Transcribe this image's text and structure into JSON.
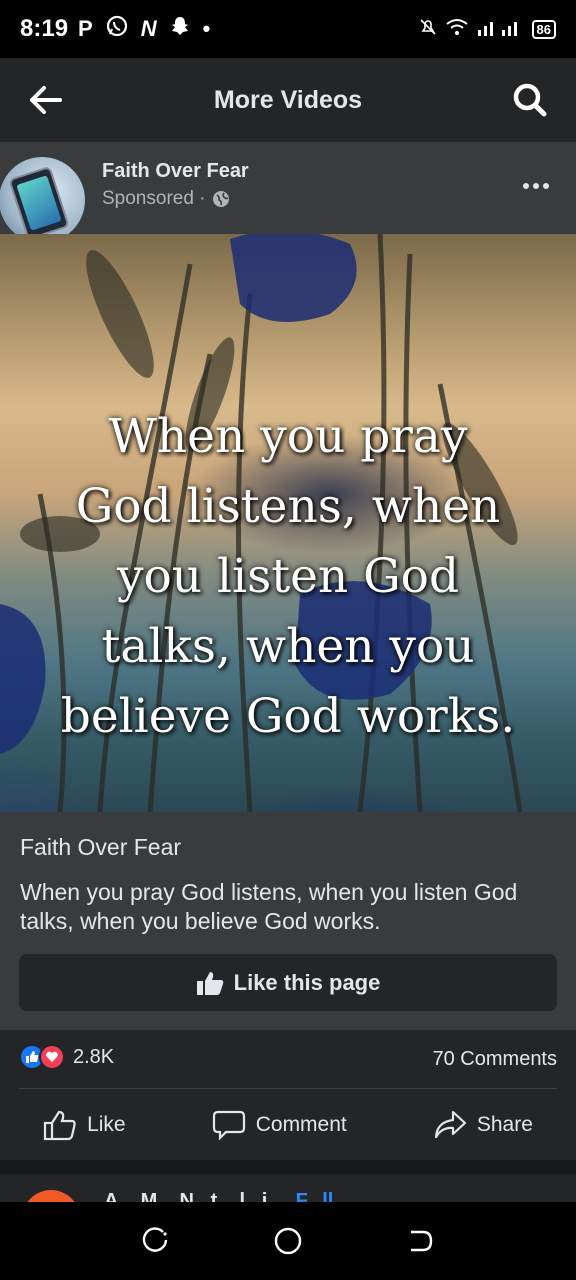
{
  "status_bar": {
    "time": "8:19",
    "left_icons": [
      "P",
      "whatsapp-icon",
      "N",
      "snapchat-icon",
      "•"
    ],
    "battery": "86"
  },
  "top_bar": {
    "title": "More Videos"
  },
  "post": {
    "page_name": "Faith Over Fear",
    "sponsored": "Sponsored ·",
    "image_quote": [
      "When you pray",
      "God listens, when",
      "you listen God",
      "talks, when you",
      "believe God works."
    ],
    "caption_title": "Faith Over Fear",
    "caption_text": "When you pray God listens, when you listen God talks, when you believe God works.",
    "like_page_label": "Like this page"
  },
  "feedback": {
    "reaction_count": "2.8K",
    "comment_count": "70 Comments",
    "actions": {
      "like": "Like",
      "comment": "Comment",
      "share": "Share"
    }
  },
  "next_post": {
    "name": "A... M... N...t... l...i...",
    "follow": "F...ll..."
  },
  "colors": {
    "surface": "#242526",
    "card": "#3a3b3c",
    "text": "#e4e6eb",
    "muted": "#b0b3b8",
    "like_blue": "#1877f2",
    "love_red": "#f33e58"
  }
}
